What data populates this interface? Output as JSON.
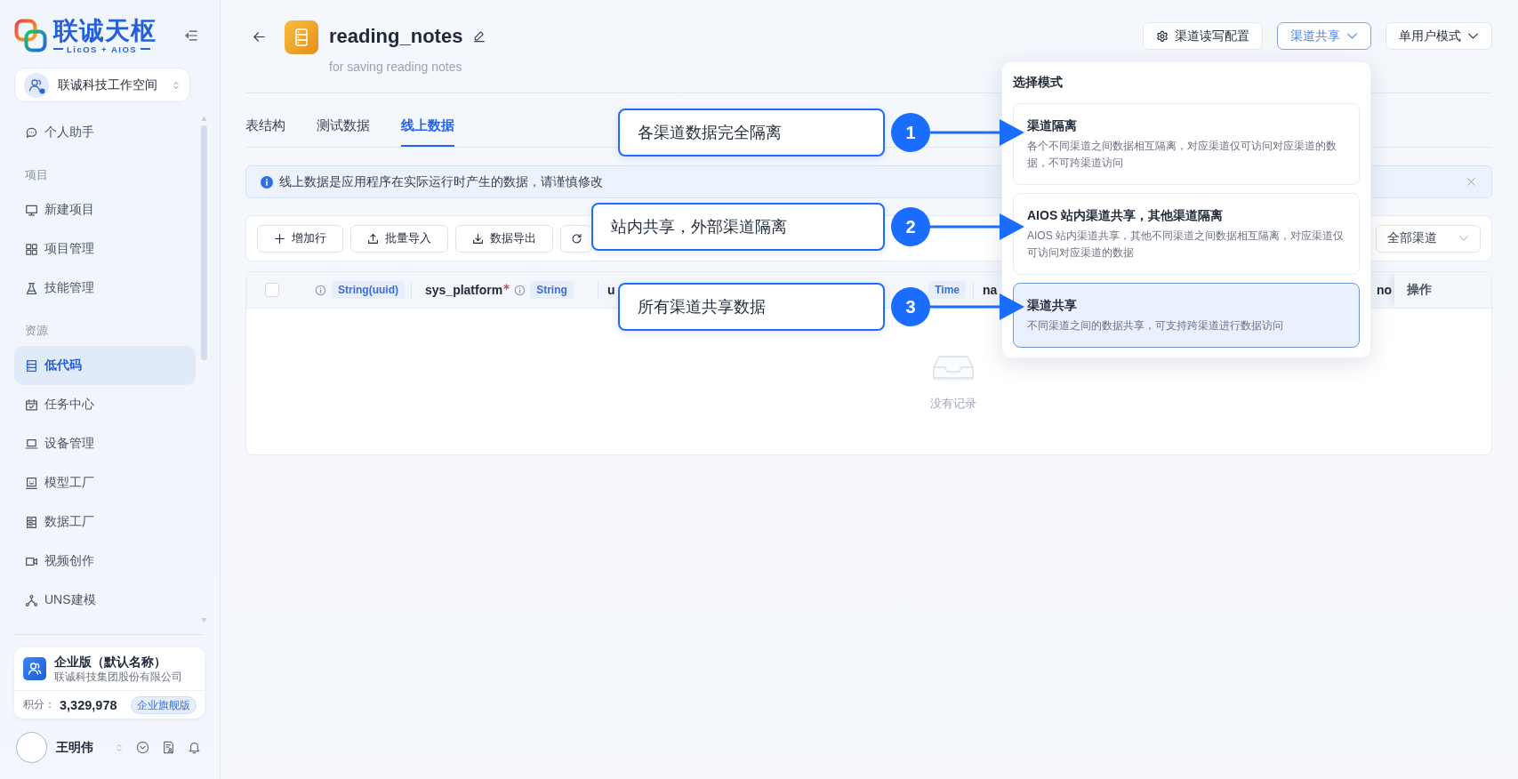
{
  "sidebar": {
    "logo": {
      "name": "联诚天枢",
      "tagline": "LicOS + AIOS"
    },
    "workspace": {
      "name": "联诚科技工作空间"
    },
    "nav": [
      {
        "kind": "item",
        "label": "个人助手",
        "selected": false
      },
      {
        "kind": "section",
        "label": "项目"
      },
      {
        "kind": "item",
        "label": "新建项目",
        "selected": false
      },
      {
        "kind": "item",
        "label": "项目管理",
        "selected": false
      },
      {
        "kind": "item",
        "label": "技能管理",
        "selected": false
      },
      {
        "kind": "section",
        "label": "资源"
      },
      {
        "kind": "item",
        "label": "低代码",
        "selected": true
      },
      {
        "kind": "item",
        "label": "任务中心",
        "selected": false
      },
      {
        "kind": "item",
        "label": "设备管理",
        "selected": false
      },
      {
        "kind": "item",
        "label": "模型工厂",
        "selected": false
      },
      {
        "kind": "item",
        "label": "数据工厂",
        "selected": false
      },
      {
        "kind": "item",
        "label": "视频创作",
        "selected": false
      },
      {
        "kind": "item",
        "label": "UNS建模",
        "selected": false
      }
    ],
    "plan": {
      "title": "企业版（默认名称）",
      "company": "联诚科技集团股份有限公司",
      "points_label": "积分：",
      "points": "3,329,978",
      "badge": "企业旗舰版"
    },
    "user": {
      "name": "王明伟"
    }
  },
  "header": {
    "title": "reading_notes",
    "subtitle": "for saving reading notes",
    "actions": [
      {
        "kind": "settings",
        "label": "渠道读写配置",
        "active": false
      },
      {
        "kind": "dropdown",
        "label": "渠道共享",
        "active": true
      },
      {
        "kind": "dropdown",
        "label": "单用户模式",
        "active": false
      }
    ]
  },
  "tabs": [
    {
      "label": "表结构",
      "selected": false
    },
    {
      "label": "测试数据",
      "selected": false
    },
    {
      "label": "线上数据",
      "selected": true
    }
  ],
  "notice": {
    "text": "线上数据是应用程序在实际运行时产生的数据，请谨慎修改"
  },
  "toolbar": {
    "buttons": [
      "增加行",
      "批量导入",
      "数据导出"
    ],
    "channel_filter": "全部渠道"
  },
  "table": {
    "select_all": {
      "checked": false
    },
    "columns": [
      {
        "type": "String(uuid)",
        "required": false,
        "info": true,
        "pinned": false
      },
      {
        "name": "sys_platform",
        "type": "String",
        "required": true,
        "info": true,
        "pinned": false
      },
      {
        "name": "u",
        "type": "Time",
        "required": false,
        "info": false,
        "pinned": false
      },
      {
        "name": "na",
        "required": false,
        "info": false,
        "pinned": false
      },
      {
        "name": "no",
        "required": false,
        "info": false,
        "pinned": false
      },
      {
        "name": "操作",
        "required": false,
        "info": false,
        "pinned": true
      }
    ],
    "empty_text": "没有记录"
  },
  "mode_menu": {
    "title": "选择模式",
    "options": [
      {
        "title": "渠道隔离",
        "description": "各个不同渠道之间数据相互隔离，对应渠道仅可访问对应渠道的数据，不可跨渠道访问",
        "selected": false
      },
      {
        "title": "AIOS 站内渠道共享，其他渠道隔离",
        "description": "AIOS 站内渠道共享，其他不同渠道之间数据相互隔离，对应渠道仅可访问对应渠道的数据",
        "selected": false
      },
      {
        "title": "渠道共享",
        "description": "不同渠道之间的数据共享，可支持跨渠道进行数据访问",
        "selected": true
      }
    ]
  },
  "annotations": [
    {
      "number": "1",
      "text": "各渠道数据完全隔离"
    },
    {
      "number": "2",
      "text": "站内共享，外部渠道隔离"
    },
    {
      "number": "3",
      "text": "所有渠道共享数据"
    }
  ]
}
